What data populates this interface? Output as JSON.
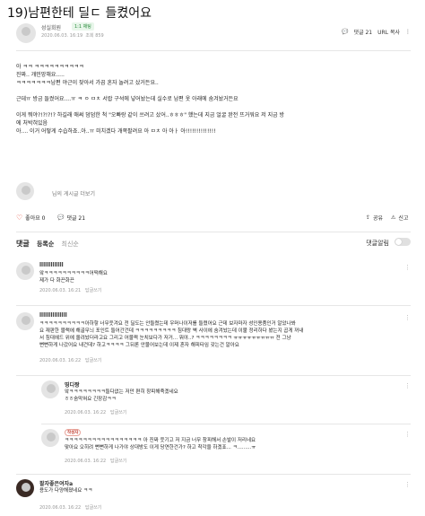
{
  "post": {
    "title": "19)남편한테 딜ㄷ 들켰어요",
    "author": "성실회원",
    "chat_badge": "1:1 채팅",
    "date": "2020.06.03. 16:19",
    "views": "조회 859",
    "comment_count": "댓글 21",
    "url_copy": "URL 복사"
  },
  "body": {
    "l1": "아 ㅋㅋ ㅋㅋㅋㅋㅋㅋㅋㅋㅋㅋ",
    "l2": "진짜.. 개민망해요.....",
    "l3": "ㅋㅋㅋㅋㅋㅋㅋ남편 야근이 잦아서 가끔 혼자 놀려고 샀거든요..",
    "l4": "근데ㅠ 방금 들켰어요....ㅠ ㅋ ㅇ ㅁㅊ 서랍 구석에 넣어놨는데 실수로 남편 옷 아래에 숨겨놨거든요",
    "l5": "이게 뭐야?!?!?!? 하길래 애써 덤덤한 척 \"오빠랑 같이 쓰려고 샀어..ㅎㅎㅎ\" 했는데 지금 얼굴 완전 뜨거워요 저 지금 방",
    "l6": "에 처박혀있음",
    "l7": "아.... 이거 어떻게 수습하죠..아..ㅠ 미치겠다 개쪽팔려요 아 ㅁㅊ 아 아ㅏ 아!!!!!!!!!!!!!!"
  },
  "profile": {
    "link": "님의 게시글 더보기"
  },
  "actions": {
    "likes": "좋아요 0",
    "comments": "댓글 21",
    "share": "공유",
    "report": "신고"
  },
  "comments_header": {
    "title": "댓글",
    "sort_reg": "등록순",
    "sort_new": "최신순",
    "alarm": "댓글알림"
  },
  "comments": [
    {
      "name": "lllllllllllll",
      "l1": "앜ㅋㅋㅋㅋㅋㅋㅋㅋㅋㅋ어떡해요",
      "l2": "제가 다 화끈화끈",
      "date": "2020.06.03. 16:21",
      "reply": "답글쓰기"
    },
    {
      "name": "lllllllllllllll",
      "l1": "ㅋㅋㅋㅋㅋㅋㅋㅋㅋㅋ아하핳 너무웃겨요 전 딜도는 안들켰는데 우머나이저를 들켰어요 근데 보자마자 성인용품인거 알았나봐",
      "l2": "요 재판한 블랙에 해골무늬 포인트 들어간건데 ㅋㅋㅋㅋㅋㅋㅋㅋㅋ 침대랑 벽 사이에 숨겨놨는데 이불 정리하다 봤는지 곱게 꺼내",
      "l3": "서 침대헤드 위에 올려놨더라고요 그리고 어물쩍 눈치보다가 저거... 뭐야..? ㅋㅋㅋㅋㅋㅋㅋㅋ ㅠㅠㅠㅠㅠㅠㅠㅠㅠ 전 그냥",
      "l4": "뻔뻔하게 나갔어요 내건데? 하고ㅋㅋㅋㅋ 그뒤론 안물어보는데 이제 혼자 해피타임 갖는건 알아요",
      "date": "2020.06.03. 16:22",
      "reply": "답글쓰기"
    },
    {
      "name": "띵디짱",
      "l1": "앜ㅋㅋㅋㅋㅋㅋㅋㅋ들다없는 저만 편히 창피해죽겠네요",
      "l2": "ㅎㅎ숨막혀요 긴장감ㅋㅋ",
      "date": "2020.06.03. 16:22",
      "reply": "답글쓰기"
    },
    {
      "name": "",
      "badge": "작성자",
      "l1": "ㅋㅋㅋㅋㅋㅋㅋㅋㅋㅋㅋㅋㅋㅋㅋㅋㅋ 아 진짜 웃기고 저 지금 너무 창피해서 손발이 저리네요",
      "l2": "맞아요 오히려 뻔뻔하게 나가야 상대방도 이게 당연한건가? 하고 착각을 하겠죠... ㅋ.........ㅠ",
      "date": "2020.06.03. 16:22",
      "reply": "답글쓰기"
    },
    {
      "name": "팔자좋은여자a",
      "l1": "용도가 다양해졌네요 ㅋㅋ",
      "date": "2020.06.03. 16:22",
      "reply": "답글쓰기"
    }
  ]
}
